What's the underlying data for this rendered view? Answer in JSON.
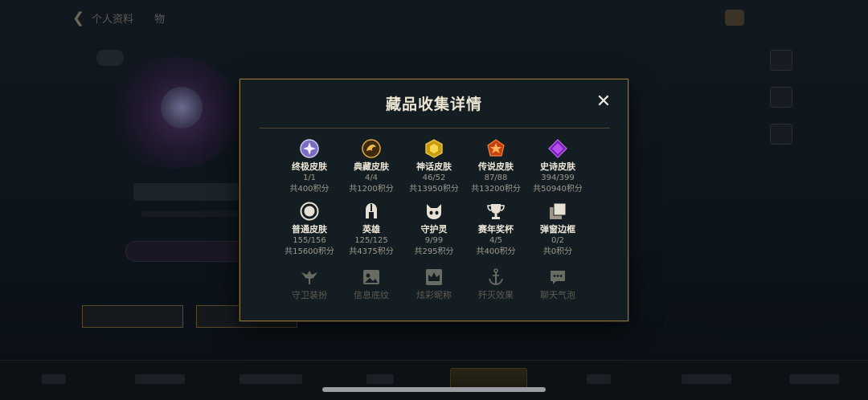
{
  "background": {
    "title": "个人资料",
    "title_suffix": "物"
  },
  "modal": {
    "title": "藏品收集详情",
    "close_label": "✕",
    "rows": [
      [
        {
          "name": "终极皮肤",
          "count": "1/1",
          "points": "共400积分",
          "icon": "ultimate-skin-icon"
        },
        {
          "name": "典藏皮肤",
          "count": "4/4",
          "points": "共1200积分",
          "icon": "mythic-skin-icon"
        },
        {
          "name": "神话皮肤",
          "count": "46/52",
          "points": "共13950积分",
          "icon": "myth-skin-icon"
        },
        {
          "name": "传说皮肤",
          "count": "87/88",
          "points": "共13200积分",
          "icon": "legendary-skin-icon"
        },
        {
          "name": "史诗皮肤",
          "count": "394/399",
          "points": "共50940积分",
          "icon": "epic-skin-icon"
        }
      ],
      [
        {
          "name": "普通皮肤",
          "count": "155/156",
          "points": "共15600积分",
          "icon": "standard-skin-icon"
        },
        {
          "name": "英雄",
          "count": "125/125",
          "points": "共4375积分",
          "icon": "champion-helmet-icon"
        },
        {
          "name": "守护灵",
          "count": "9/99",
          "points": "共295积分",
          "icon": "guardian-icon"
        },
        {
          "name": "赛年奖杯",
          "count": "4/5",
          "points": "共400积分",
          "icon": "trophy-icon"
        },
        {
          "name": "弹窗边框",
          "count": "0/2",
          "points": "共0积分",
          "icon": "frame-icon"
        }
      ],
      [
        {
          "name": "守卫装扮",
          "icon": "ward-skin-icon"
        },
        {
          "name": "信息底纹",
          "icon": "banner-icon"
        },
        {
          "name": "炫彩昵称",
          "icon": "crown-icon"
        },
        {
          "name": "歼灭效果",
          "icon": "anchor-icon"
        },
        {
          "name": "聊天气泡",
          "icon": "chat-bubble-icon"
        }
      ]
    ]
  },
  "colors": {
    "modal_bg": "#141d22",
    "border_gold": "#8a7345",
    "title": "#ece5d2",
    "sub_text": "#9d9a90"
  }
}
